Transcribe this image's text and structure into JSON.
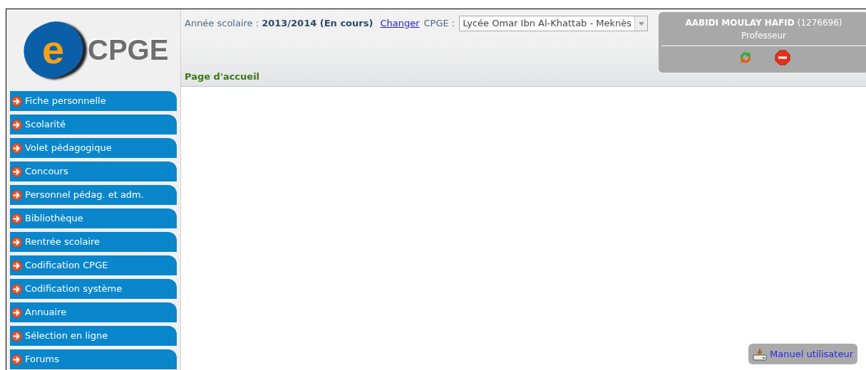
{
  "logo": {
    "letter": "e",
    "text": "CPGE"
  },
  "header": {
    "year_label": "Année scolaire :",
    "year_value": "2013/2014 (En cours)",
    "change_link": "Changer",
    "cpge_label": "CPGE :",
    "cpge_value": "Lycée Omar Ibn Al-Khattab - Meknès",
    "page_title": "Page d'accueil"
  },
  "user": {
    "name": "AABIDI MOULAY HAFID",
    "id": "(1276696)",
    "role": "Professeur"
  },
  "menu": [
    {
      "label": "Fiche personnelle"
    },
    {
      "label": "Scolarité"
    },
    {
      "label": "Volet pédagogique"
    },
    {
      "label": "Concours"
    },
    {
      "label": "Personnel pédag. et adm."
    },
    {
      "label": "Bibliothèque"
    },
    {
      "label": "Rentrée scolaire"
    },
    {
      "label": "Codification CPGE"
    },
    {
      "label": "Codification système"
    },
    {
      "label": "Annuaire"
    },
    {
      "label": "Sélection en ligne"
    },
    {
      "label": "Forums"
    }
  ],
  "manual_button": "Manuel utilisateur"
}
